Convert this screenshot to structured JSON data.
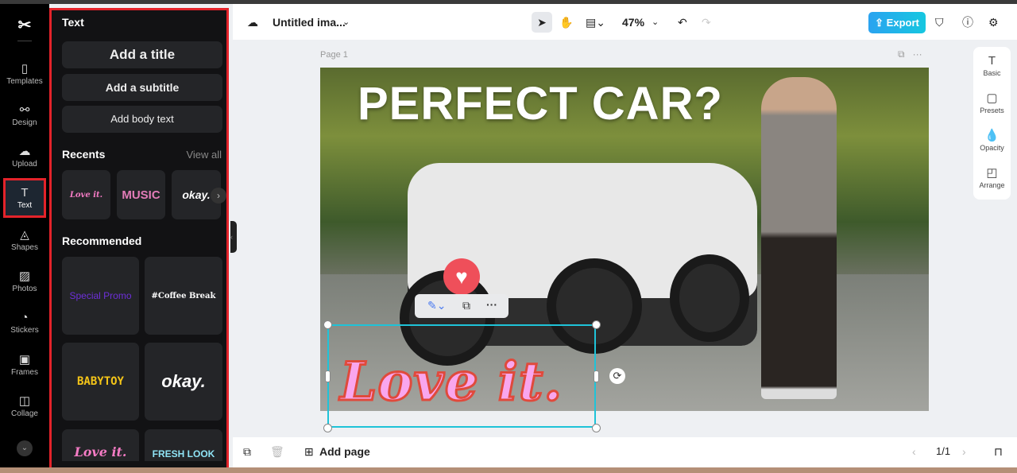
{
  "rail": {
    "items": [
      {
        "label": "Templates",
        "icon": "templates-icon"
      },
      {
        "label": "Design",
        "icon": "design-icon"
      },
      {
        "label": "Upload",
        "icon": "upload-icon"
      },
      {
        "label": "Text",
        "icon": "text-icon"
      },
      {
        "label": "Shapes",
        "icon": "shapes-icon"
      },
      {
        "label": "Photos",
        "icon": "photos-icon"
      },
      {
        "label": "Stickers",
        "icon": "stickers-icon"
      },
      {
        "label": "Frames",
        "icon": "frames-icon"
      },
      {
        "label": "Collage",
        "icon": "collage-icon"
      }
    ]
  },
  "panel": {
    "title": "Text",
    "add_title": "Add a title",
    "add_subtitle": "Add a subtitle",
    "add_body": "Add body text",
    "recents": "Recents",
    "view_all": "View all",
    "recent_items": [
      "Love it.",
      "MUSIC",
      "okay."
    ],
    "recommended": "Recommended",
    "recommended_items": [
      "Special Promo",
      "#Coffee Break",
      "BABYTOY",
      "okay.",
      "Love it.",
      "FRESH LOOK"
    ]
  },
  "header": {
    "doc_title": "Untitled ima...",
    "zoom": "47%",
    "export": "Export"
  },
  "canvas": {
    "page_label": "Page 1",
    "headline": "PERFECT CAR?",
    "selected_text": "Love it."
  },
  "right_panel": {
    "items": [
      "Basic",
      "Presets",
      "Opacity",
      "Arrange"
    ]
  },
  "bottom": {
    "add_page": "Add page",
    "page_count": "1/1"
  },
  "colors": {
    "accent": "#1fc3d8",
    "highlight": "#e3232a"
  }
}
